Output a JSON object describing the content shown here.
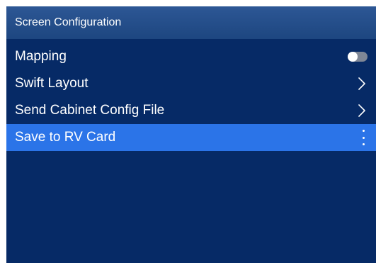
{
  "header": {
    "title": "Screen Configuration"
  },
  "menu": {
    "items": [
      {
        "label": "Mapping",
        "control": "toggle",
        "toggle_state": "off"
      },
      {
        "label": "Swift Layout",
        "control": "chevron-right-icon"
      },
      {
        "label": "Send Cabinet Config File",
        "control": "chevron-right-icon"
      },
      {
        "label": "Save to RV Card",
        "control": "more-vertical-icon",
        "selected": true
      }
    ]
  },
  "colors": {
    "panel_background": "#062a66",
    "header_background": "#234c88",
    "selected_background": "#2b74e8",
    "text": "#ffffff"
  }
}
